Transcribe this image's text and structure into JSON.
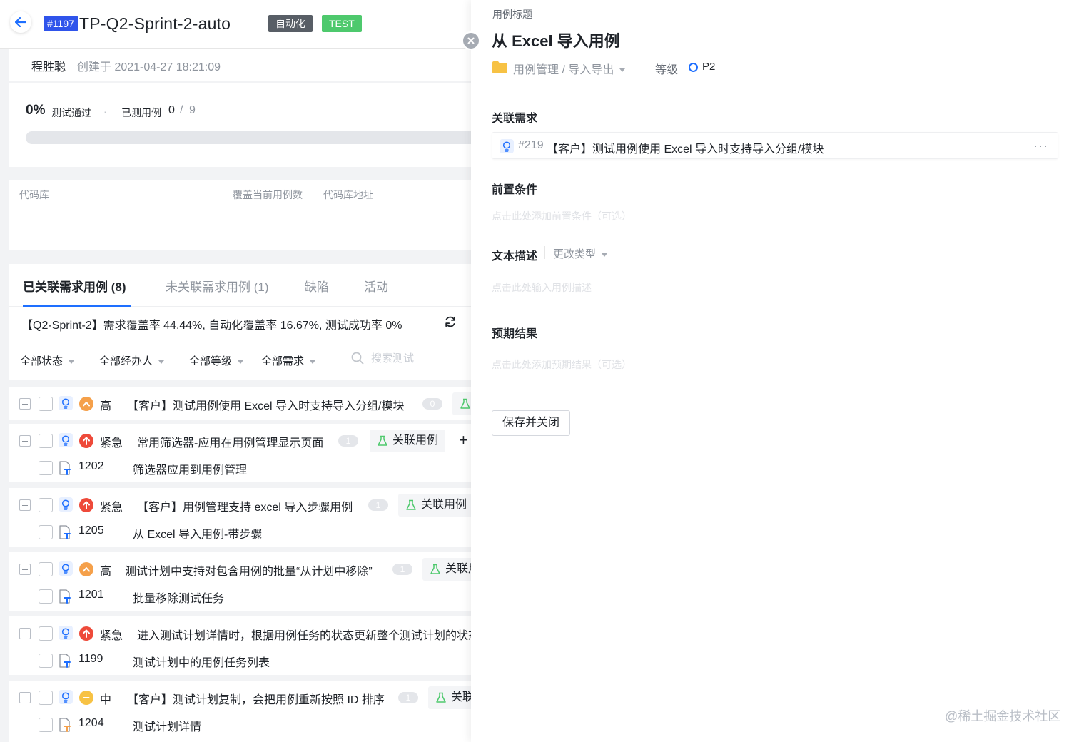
{
  "header": {
    "plan_id": "#1197",
    "plan_title": "TP-Q2-Sprint-2-auto",
    "tag_auto": "自动化",
    "tag_test": "TEST",
    "author": "程胜聪",
    "created": "创建于 2021-04-27 18:21:09"
  },
  "progress": {
    "pass_pct": "0%",
    "pass_label": "测试通过",
    "dot": "·",
    "tested_label": "已测用例",
    "tested": "0",
    "sep": "/",
    "total": "9",
    "fill_fraction": 0.0
  },
  "repo": {
    "col_repo": "代码库",
    "col_cover": "覆盖当前用例数",
    "col_addr": "代码库地址"
  },
  "tabs": [
    {
      "label": "已关联需求用例 (8)"
    },
    {
      "label": "未关联需求用例 (1)"
    },
    {
      "label": "缺陷"
    },
    {
      "label": "活动"
    }
  ],
  "summary": "【Q2-Sprint-2】需求覆盖率 44.44%, 自动化覆盖率 16.67%, 测试成功率 0%",
  "filters": {
    "status": "全部状态",
    "assignee": "全部经办人",
    "level": "全部等级",
    "req": "全部需求",
    "search_placeholder": "搜索测试"
  },
  "link_label": "关联用例",
  "plus": "+",
  "groups": [
    {
      "priority": "高",
      "pri_color": "#f5a04a",
      "title": "【客户】测试用例使用 Excel 导入时支持导入分组/模块",
      "count": "0",
      "link": "关联用例"
    },
    {
      "priority": "紧急",
      "pri_color": "#ee4a3a",
      "title": "常用筛选器-应用在用例管理显示页面",
      "count": "1",
      "link": "关联用例",
      "case_id": "1202",
      "case_title": "筛选器应用到用例管理"
    },
    {
      "priority": "紧急",
      "pri_color": "#ee4a3a",
      "title": "【客户】用例管理支持 excel 导入步骤用例",
      "count": "1",
      "link": "关联用例",
      "case_id": "1205",
      "case_title": "从 Excel 导入用例-带步骤"
    },
    {
      "priority": "高",
      "pri_color": "#f5a04a",
      "title": "测试计划中支持对包含用例的批量“从计划中移除”",
      "count": "1",
      "link": "关联用例",
      "case_id": "1201",
      "case_title": "批量移除测试任务"
    },
    {
      "priority": "紧急",
      "pri_color": "#ee4a3a",
      "title": "进入测试计划详情时，根据用例任务的状态更新整个测试计划的状态",
      "case_id": "1199",
      "case_title": "测试计划中的用例任务列表"
    },
    {
      "priority": "中",
      "pri_color": "#f7c244",
      "title": "【客户】测试计划复制，会把用例重新按照 ID 排序",
      "count": "1",
      "link": "关联用例",
      "case_id": "1204",
      "case_title": "测试计划详情"
    }
  ],
  "drawer": {
    "caption": "用例标题",
    "title": "从 Excel 导入用例",
    "path": "用例管理 / 导入导出",
    "level_label": "等级",
    "level_value": "P2",
    "sec_req": "关联需求",
    "req_id": "#219",
    "req_title": "【客户】测试用例使用 Excel 导入时支持导入分组/模块",
    "more": "···",
    "sec_pre": "前置条件",
    "pre_placeholder": "点击此处添加前置条件（可选）",
    "sec_desc": "文本描述",
    "change_type": "更改类型",
    "desc_placeholder": "点击此处输入用例描述",
    "sec_expect": "预期结果",
    "expect_placeholder": "点击此处添加预期结果（可选）",
    "save_btn": "保存并关闭"
  },
  "watermark": "@稀土掘金技术社区",
  "colors": {
    "accent": "#1e6fff",
    "id_badge": "#2f54eb",
    "tag_auto": "#585e66",
    "tag_test": "#4ec96d",
    "link_green": "#4ec96d"
  }
}
